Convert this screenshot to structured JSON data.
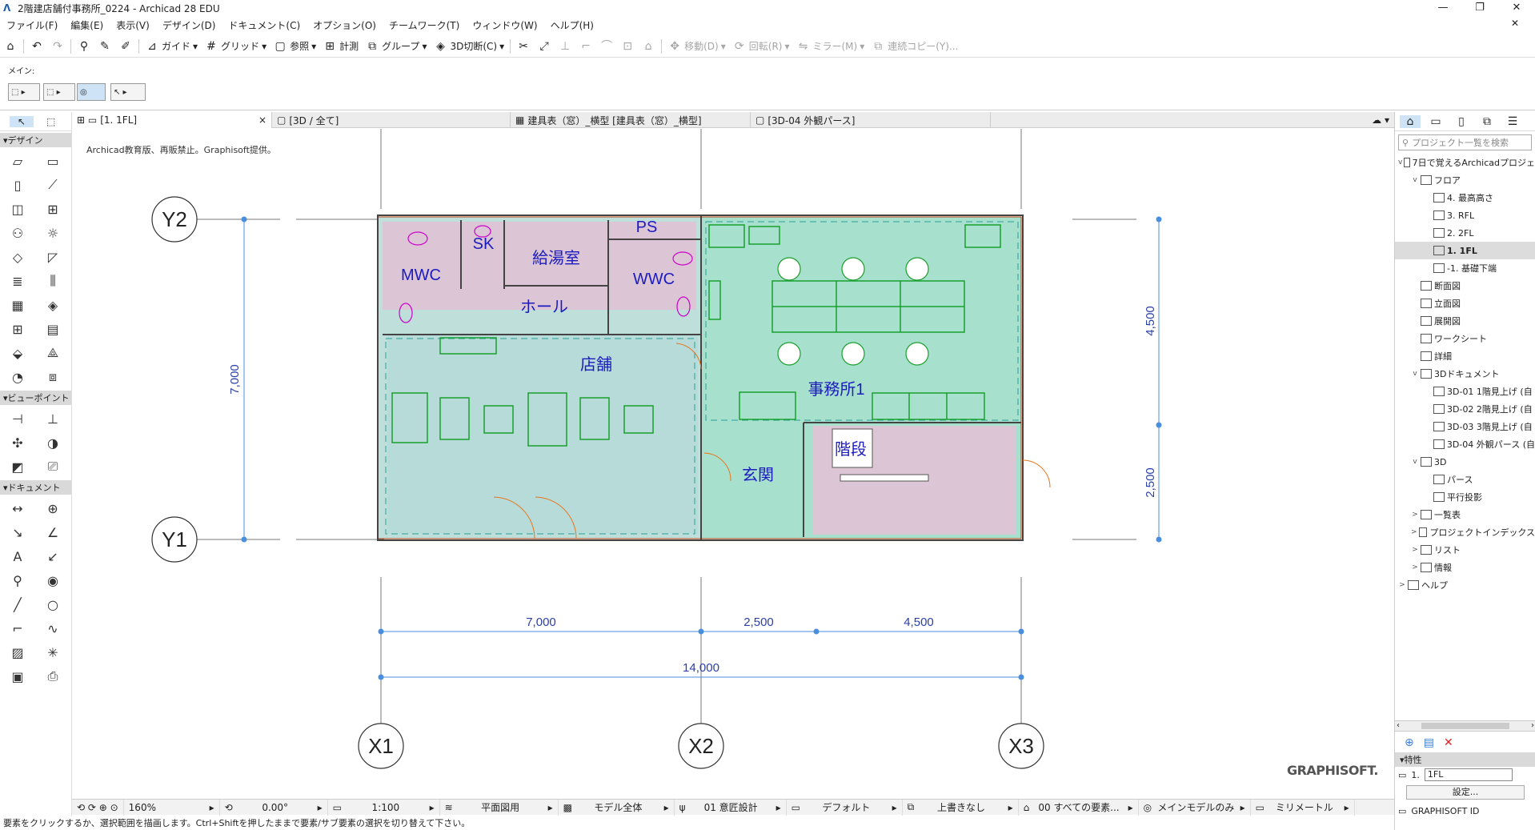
{
  "window": {
    "title": "2階建店舗付事務所_0224 - Archicad 28 EDU",
    "minimize": "—",
    "restore": "❐",
    "close": "✕"
  },
  "menu": [
    "ファイル(F)",
    "編集(E)",
    "表示(V)",
    "デザイン(D)",
    "ドキュメント(C)",
    "オプション(O)",
    "チームワーク(T)",
    "ウィンドウ(W)",
    "ヘルプ(H)"
  ],
  "menu_close": "✕",
  "toolbar": {
    "guide": "ガイド",
    "grid": "グリッド",
    "ref": "参照",
    "measure": "計測",
    "group": "グループ",
    "cut3d": "3D切断(C)",
    "move": "移動(D)",
    "rotate": "回転(R)",
    "mirror": "ミラー(M)",
    "multicopy": "連続コピー(Y)..."
  },
  "infobox": {
    "label": "メイン:"
  },
  "toolbox": {
    "design": "デザイン",
    "viewpoint": "ビューポイント",
    "document": "ドキュメント"
  },
  "tabs": [
    {
      "label": "[1. 1FL]",
      "close": "×"
    },
    {
      "label": "[3D / 全て]"
    },
    {
      "label": "建具表（窓）_横型 [建具表（窓）_横型]"
    },
    {
      "label": "[3D-04 外観パース]"
    }
  ],
  "canvas": {
    "notice": "Archicad教育版、再販禁止。Graphisoft提供。",
    "logo": "GRAPHISOFT.",
    "grid_labels": {
      "y2": "Y2",
      "y1": "Y1",
      "x1": "X1",
      "x2": "X2",
      "x3": "X3"
    },
    "dims": {
      "left": "7,000",
      "right_top": "4,500",
      "right_bottom": "2,500",
      "b1": "7,000",
      "b2": "2,500",
      "b3": "4,500",
      "total": "14,000"
    },
    "rooms": {
      "mwc": "MWC",
      "sk": "SK",
      "kyuto": "給湯室",
      "ps": "PS",
      "wwc": "WWC",
      "hall": "ホール",
      "store": "店舗",
      "office": "事務所1",
      "entrance": "玄関",
      "stairs": "階段"
    }
  },
  "statusbar": {
    "zoom": "160%",
    "angle": "0.00°",
    "scale": "1:100",
    "layer_combo": "平面図用",
    "model": "モデル全体",
    "design": "01 意匠設計",
    "default": "デフォルト",
    "override": "上書きなし",
    "filter": "00 すべての要素...",
    "mainmodel": "メインモデルのみ",
    "unit": "ミリメートル"
  },
  "hint": "要素をクリックするか、選択範囲を描画します。Ctrl+Shiftを押したままで要素/サブ要素の選択を切り替えて下さい。",
  "navigator": {
    "search_placeholder": "プロジェクト一覧を検索",
    "tree": [
      {
        "label": "7日で覚えるArchicadプロジェ",
        "lvl": 0,
        "tw": "v"
      },
      {
        "label": "フロア",
        "lvl": 1,
        "tw": "v"
      },
      {
        "label": "4. 最高高さ",
        "lvl": 2,
        "tw": ""
      },
      {
        "label": "3. RFL",
        "lvl": 2,
        "tw": ""
      },
      {
        "label": "2. 2FL",
        "lvl": 2,
        "tw": ""
      },
      {
        "label": "1. 1FL",
        "lvl": 2,
        "tw": "",
        "sel": true
      },
      {
        "label": "-1. 基礎下端",
        "lvl": 2,
        "tw": ""
      },
      {
        "label": "断面図",
        "lvl": 1,
        "tw": ""
      },
      {
        "label": "立面図",
        "lvl": 1,
        "tw": ""
      },
      {
        "label": "展開図",
        "lvl": 1,
        "tw": ""
      },
      {
        "label": "ワークシート",
        "lvl": 1,
        "tw": ""
      },
      {
        "label": "詳細",
        "lvl": 1,
        "tw": ""
      },
      {
        "label": "3Dドキュメント",
        "lvl": 1,
        "tw": "v"
      },
      {
        "label": "3D-01 1階見上げ (自",
        "lvl": 2,
        "tw": ""
      },
      {
        "label": "3D-02 2階見上げ (自",
        "lvl": 2,
        "tw": ""
      },
      {
        "label": "3D-03 3階見上げ (自",
        "lvl": 2,
        "tw": ""
      },
      {
        "label": "3D-04 外観パース (自",
        "lvl": 2,
        "tw": ""
      },
      {
        "label": "3D",
        "lvl": 1,
        "tw": "v"
      },
      {
        "label": "パース",
        "lvl": 2,
        "tw": ""
      },
      {
        "label": "平行投影",
        "lvl": 2,
        "tw": ""
      },
      {
        "label": "一覧表",
        "lvl": 1,
        "tw": ">"
      },
      {
        "label": "プロジェクトインデックス",
        "lvl": 1,
        "tw": ">"
      },
      {
        "label": "リスト",
        "lvl": 1,
        "tw": ">"
      },
      {
        "label": "情報",
        "lvl": 1,
        "tw": ">"
      },
      {
        "label": "ヘルプ",
        "lvl": 0,
        "tw": ">"
      }
    ],
    "props_header": "特性",
    "props_num": "1.",
    "props_value": "1FL",
    "settings_btn": "設定...",
    "gs_id": "GRAPHISOFT ID"
  }
}
